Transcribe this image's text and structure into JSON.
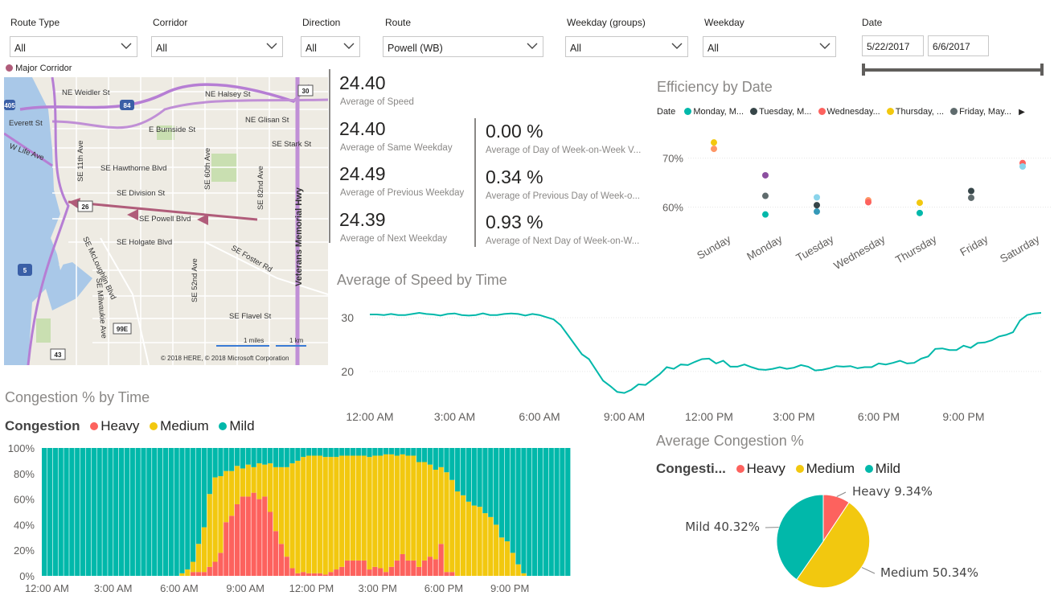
{
  "slicers": [
    {
      "label": "Route Type",
      "value": "All"
    },
    {
      "label": "Corridor",
      "value": "All"
    },
    {
      "label": "Direction",
      "value": "All"
    },
    {
      "label": "Route",
      "value": "Powell (WB)"
    },
    {
      "label": "Weekday (groups)",
      "value": "All"
    },
    {
      "label": "Weekday",
      "value": "All"
    }
  ],
  "date_slicer": {
    "label": "Date",
    "start": "5/22/2017",
    "end": "6/6/2017"
  },
  "map": {
    "legend": "Major Corridor",
    "legend_color": "#b05c7a",
    "streets": [
      "NE Weidler St",
      "NE Halsey St",
      "NE Glisan St",
      "E Burnside St",
      "SE Stark St",
      "SE Hawthorne Blvd",
      "SE Division St",
      "SE Powell Blvd",
      "SE Holgate Blvd",
      "SE Foster Rd",
      "SE Flavel St",
      "SE 11th Ave",
      "SE 60th Ave",
      "SE 82nd Ave",
      "SE 52nd Ave",
      "SE McLoughlin Blvd",
      "SE Milwaukie Ave",
      "Veterans Memorial Hwy",
      "Everett St",
      "W Life Ave"
    ],
    "shields": [
      "84",
      "30",
      "26",
      "5",
      "99E",
      "43",
      "405"
    ],
    "scale_miles": "1 miles",
    "scale_km": "1 km",
    "copyright": "© 2018 HERE, © 2018 Microsoft Corporation"
  },
  "cards": {
    "avg_speed": {
      "value": "24.40",
      "label": "Average of Speed"
    },
    "same_weekday": {
      "value": "24.40",
      "label": "Average of Same Weekday"
    },
    "prev_weekday": {
      "value": "24.49",
      "label": "Average of Previous Weekday"
    },
    "next_weekday": {
      "value": "24.39",
      "label": "Average of Next Weekday"
    },
    "dow_wow": {
      "value": "0.00 %",
      "label": "Average of Day of Week-on-Week V..."
    },
    "prev_dow": {
      "value": "0.34 %",
      "label": "Average of Previous Day of Week-o..."
    },
    "next_dow": {
      "value": "0.93 %",
      "label": "Average of Next Day of Week-on-W..."
    }
  },
  "chart_data": [
    {
      "type": "scatter",
      "title": "Efficiency by Date",
      "legend_title": "Date",
      "legend": [
        {
          "name": "Monday, M...",
          "color": "#01b8aa"
        },
        {
          "name": "Tuesday, M...",
          "color": "#374649"
        },
        {
          "name": "Wednesday...",
          "color": "#fd625e"
        },
        {
          "name": "Thursday, ...",
          "color": "#f2c80f"
        },
        {
          "name": "Friday, May...",
          "color": "#5f6b6d"
        }
      ],
      "categories": [
        "Sunday",
        "Monday",
        "Tuesday",
        "Wednesday",
        "Thursday",
        "Friday",
        "Saturday"
      ],
      "y_ticks": [
        "70%",
        "60%"
      ],
      "ylim": [
        55,
        77
      ],
      "points": [
        {
          "cat": 0,
          "y": 73.2,
          "color": "#f2c80f"
        },
        {
          "cat": 0,
          "y": 71.9,
          "color": "#fe9666"
        },
        {
          "cat": 1,
          "y": 66.5,
          "color": "#8c4fa0"
        },
        {
          "cat": 1,
          "y": 62.3,
          "color": "#5f6b6d"
        },
        {
          "cat": 1,
          "y": 58.5,
          "color": "#01b8aa"
        },
        {
          "cat": 2,
          "y": 62.0,
          "color": "#8ad4eb"
        },
        {
          "cat": 2,
          "y": 60.4,
          "color": "#374649"
        },
        {
          "cat": 2,
          "y": 59.1,
          "color": "#3599b8"
        },
        {
          "cat": 3,
          "y": 61.4,
          "color": "#fe9666"
        },
        {
          "cat": 3,
          "y": 61.0,
          "color": "#fd625e"
        },
        {
          "cat": 4,
          "y": 60.9,
          "color": "#f2c80f"
        },
        {
          "cat": 4,
          "y": 58.8,
          "color": "#01b8aa"
        },
        {
          "cat": 5,
          "y": 63.3,
          "color": "#374649"
        },
        {
          "cat": 5,
          "y": 61.9,
          "color": "#5f6b6d"
        },
        {
          "cat": 6,
          "y": 69.0,
          "color": "#fd625e"
        },
        {
          "cat": 6,
          "y": 68.3,
          "color": "#8ad4eb"
        }
      ]
    },
    {
      "type": "line",
      "title": "Average of Speed by Time",
      "color": "#01b8aa",
      "x_ticks": [
        "12:00 AM",
        "3:00 AM",
        "6:00 AM",
        "9:00 AM",
        "12:00 PM",
        "3:00 PM",
        "6:00 PM",
        "9:00 PM"
      ],
      "y_ticks": [
        30,
        20
      ],
      "ylim": [
        14,
        33
      ],
      "x_hours": [
        0,
        0.25,
        0.5,
        0.75,
        1,
        1.25,
        1.5,
        1.75,
        2,
        2.25,
        2.5,
        2.75,
        3,
        3.25,
        3.5,
        3.75,
        4,
        4.25,
        4.5,
        4.75,
        5,
        5.25,
        5.5,
        5.75,
        6,
        6.25,
        6.5,
        6.75,
        7,
        7.25,
        7.5,
        7.75,
        8,
        8.25,
        8.5,
        8.75,
        9,
        9.25,
        9.5,
        9.75,
        10,
        10.25,
        10.5,
        10.75,
        11,
        11.25,
        11.5,
        11.75,
        12,
        12.25,
        12.5,
        12.75,
        13,
        13.25,
        13.5,
        13.75,
        14,
        14.25,
        14.5,
        14.75,
        15,
        15.25,
        15.5,
        15.75,
        16,
        16.25,
        16.5,
        16.75,
        17,
        17.25,
        17.5,
        17.75,
        18,
        18.25,
        18.5,
        18.75,
        19,
        19.25,
        19.5,
        19.75,
        20,
        20.25,
        20.5,
        20.75,
        21,
        21.25,
        21.5,
        21.75,
        22,
        22.25,
        22.5,
        22.75,
        23,
        23.25,
        23.5,
        23.75
      ],
      "values": [
        30.6,
        30.6,
        30.5,
        30.7,
        30.5,
        30.5,
        30.7,
        30.9,
        30.7,
        30.6,
        30.4,
        30.7,
        30.8,
        30.5,
        30.4,
        30.5,
        30.8,
        30.5,
        30.5,
        30.7,
        30.8,
        30.7,
        30.4,
        30.7,
        30.5,
        30.1,
        29.7,
        28.6,
        26.8,
        25.0,
        23.2,
        22.3,
        20.3,
        18.3,
        17.3,
        16.2,
        16.0,
        16.6,
        17.6,
        17.5,
        18.5,
        19.5,
        20.8,
        20.5,
        21.3,
        21.2,
        21.8,
        22.3,
        22.4,
        21.5,
        22.0,
        20.9,
        20.9,
        21.3,
        20.8,
        20.4,
        20.3,
        20.5,
        20.8,
        20.5,
        20.7,
        21.2,
        20.9,
        20.2,
        20.3,
        20.6,
        21.0,
        20.9,
        21.0,
        20.6,
        20.8,
        20.8,
        21.5,
        21.3,
        21.6,
        22.0,
        21.5,
        21.6,
        22.4,
        22.8,
        24.2,
        24.3,
        24.0,
        24.0,
        24.8,
        24.4,
        25.3,
        25.4,
        25.8,
        26.5,
        26.8,
        27.3,
        29.5,
        30.5,
        30.8,
        30.9
      ]
    },
    {
      "type": "bar",
      "title": "Congestion % by Time",
      "legend_title": "Congestion",
      "stacked": "100%",
      "series_colors": {
        "Heavy": "#fd625e",
        "Medium": "#f2c80f",
        "Mild": "#01b8aa"
      },
      "x_ticks": [
        "12:00 AM",
        "3:00 AM",
        "6:00 AM",
        "9:00 AM",
        "12:00 PM",
        "3:00 PM",
        "6:00 PM",
        "9:00 PM"
      ],
      "y_ticks": [
        "100%",
        "80%",
        "60%",
        "40%",
        "20%",
        "0%"
      ],
      "x_hours": [
        0,
        0.25,
        0.5,
        0.75,
        1,
        1.25,
        1.5,
        1.75,
        2,
        2.25,
        2.5,
        2.75,
        3,
        3.25,
        3.5,
        3.75,
        4,
        4.25,
        4.5,
        4.75,
        5,
        5.25,
        5.5,
        5.75,
        6,
        6.25,
        6.5,
        6.75,
        7,
        7.25,
        7.5,
        7.75,
        8,
        8.25,
        8.5,
        8.75,
        9,
        9.25,
        9.5,
        9.75,
        10,
        10.25,
        10.5,
        10.75,
        11,
        11.25,
        11.5,
        11.75,
        12,
        12.25,
        12.5,
        12.75,
        13,
        13.25,
        13.5,
        13.75,
        14,
        14.25,
        14.5,
        14.75,
        15,
        15.25,
        15.5,
        15.75,
        16,
        16.25,
        16.5,
        16.75,
        17,
        17.25,
        17.5,
        17.75,
        18,
        18.25,
        18.5,
        18.75,
        19,
        19.25,
        19.5,
        19.75,
        20,
        20.25,
        20.5,
        20.75,
        21,
        21.25,
        21.5,
        21.75,
        22,
        22.25,
        22.5,
        22.75,
        23,
        23.25,
        23.5,
        23.75
      ],
      "heavy": [
        0,
        0,
        0,
        0,
        0,
        0,
        0,
        0,
        0,
        0,
        0,
        0,
        0,
        0,
        0,
        0,
        0,
        0,
        0,
        0,
        0,
        0,
        0,
        0,
        0,
        0,
        0,
        0,
        0,
        0,
        0,
        0,
        0,
        0,
        0,
        0,
        0,
        0,
        0,
        0,
        0,
        0,
        0,
        0,
        0,
        0,
        0,
        0,
        0,
        0,
        0,
        0,
        0,
        0,
        0,
        0,
        0,
        0,
        0,
        0,
        0,
        0,
        0,
        0,
        0,
        0,
        0,
        0,
        0,
        0,
        0,
        0,
        0,
        0,
        0,
        0,
        0,
        0,
        0,
        0,
        0,
        0,
        0,
        0,
        0,
        0,
        0,
        0,
        0,
        0,
        0,
        0,
        0,
        0,
        0,
        0
      ],
      "medium": [
        0,
        0,
        0,
        0,
        0,
        0,
        0,
        0,
        0,
        0,
        0,
        0,
        0,
        0,
        0,
        0,
        0,
        0,
        0,
        0,
        0,
        0,
        0,
        0,
        0,
        0,
        0,
        0,
        0,
        0,
        0,
        0,
        0,
        0,
        0,
        0,
        0,
        0,
        0,
        0,
        0,
        0,
        0,
        0,
        0,
        0,
        0,
        0,
        0,
        0,
        0,
        0,
        0,
        0,
        0,
        0,
        0,
        0,
        0,
        0,
        0,
        0,
        0,
        0,
        0,
        0,
        0,
        0,
        0,
        0,
        0,
        0,
        0,
        0,
        0,
        0,
        0,
        0,
        0,
        0,
        0,
        0,
        0,
        0,
        0,
        0,
        0,
        0,
        0,
        0,
        0,
        0,
        0,
        0,
        0,
        0
      ],
      "heavy_pct": [
        0,
        0,
        0,
        0,
        0,
        0,
        0,
        0,
        0,
        0,
        0,
        0,
        0,
        0,
        0,
        0,
        0,
        0,
        0,
        0,
        0,
        0,
        0,
        0,
        0,
        0,
        0,
        3,
        3,
        3,
        7,
        11,
        18,
        42,
        47,
        56,
        62,
        62,
        65,
        60,
        62,
        50,
        35,
        25,
        15,
        6,
        2,
        3,
        2,
        2,
        2,
        1,
        3,
        5,
        7,
        12,
        12,
        12,
        12,
        5,
        7,
        6,
        3,
        7,
        12,
        17,
        12,
        12,
        7,
        12,
        15,
        13,
        25,
        3,
        3,
        0,
        0,
        0,
        0,
        0,
        0,
        0,
        0,
        0,
        0,
        0,
        0,
        0,
        0,
        0,
        0,
        0,
        0,
        0,
        0,
        0
      ],
      "medium_pct": [
        0,
        0,
        0,
        0,
        0,
        0,
        0,
        0,
        0,
        0,
        0,
        0,
        0,
        0,
        0,
        0,
        0,
        0,
        0,
        0,
        0,
        0,
        0,
        0,
        0,
        2,
        5,
        8,
        22,
        35,
        57,
        66,
        60,
        40,
        35,
        30,
        22,
        25,
        20,
        28,
        25,
        38,
        50,
        60,
        70,
        82,
        88,
        90,
        92,
        92,
        92,
        92,
        90,
        88,
        87,
        82,
        82,
        82,
        82,
        88,
        87,
        88,
        92,
        88,
        82,
        78,
        82,
        82,
        82,
        77,
        72,
        70,
        60,
        78,
        72,
        66,
        63,
        58,
        55,
        54,
        49,
        46,
        40,
        30,
        27,
        18,
        9,
        2,
        0,
        0,
        0,
        0,
        0,
        0,
        0,
        0
      ],
      "mild_pct": [
        100,
        100,
        100,
        100,
        100,
        100,
        100,
        100,
        100,
        100,
        100,
        100,
        100,
        100,
        100,
        100,
        100,
        100,
        100,
        100,
        100,
        100,
        100,
        100,
        100,
        98,
        95,
        89,
        75,
        62,
        36,
        23,
        22,
        18,
        18,
        14,
        16,
        13,
        15,
        12,
        13,
        12,
        15,
        15,
        15,
        12,
        10,
        7,
        6,
        6,
        6,
        7,
        7,
        7,
        6,
        6,
        6,
        6,
        6,
        7,
        6,
        6,
        5,
        5,
        6,
        5,
        6,
        6,
        11,
        11,
        13,
        17,
        15,
        19,
        25,
        34,
        37,
        42,
        45,
        46,
        51,
        54,
        60,
        70,
        73,
        82,
        91,
        98,
        100,
        100,
        100,
        100,
        100,
        100,
        100,
        100
      ]
    },
    {
      "type": "pie",
      "title": "Average Congestion %",
      "legend_title": "Congesti...",
      "slices": [
        {
          "name": "Heavy",
          "value": 9.34,
          "label": "Heavy 9.34%",
          "color": "#fd625e"
        },
        {
          "name": "Medium",
          "value": 50.34,
          "label": "Medium 50.34%",
          "color": "#f2c80f"
        },
        {
          "name": "Mild",
          "value": 40.32,
          "label": "Mild 40.32%",
          "color": "#01b8aa"
        }
      ]
    }
  ],
  "colors": {
    "heavy": "#fd625e",
    "medium": "#f2c80f",
    "mild": "#01b8aa",
    "accent_line": "#01b8aa"
  }
}
